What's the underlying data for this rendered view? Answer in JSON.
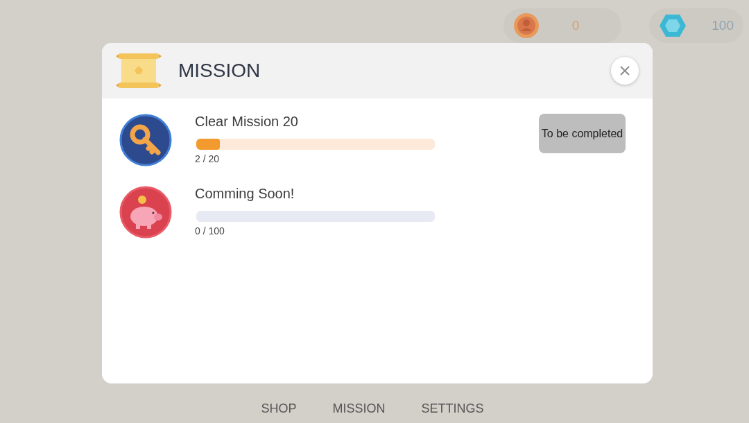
{
  "currencies": [
    {
      "kind": "coin",
      "amount": "0"
    },
    {
      "kind": "gem",
      "amount": "100"
    }
  ],
  "dialog": {
    "title": "MISSION",
    "missions": [
      {
        "kind": "key",
        "title": "Clear Mission 20",
        "level": 0.1,
        "color": "#fde9d9",
        "progress": "2 / 20",
        "action": "To be completed"
      },
      {
        "kind": "piggy",
        "title": "Comming Soon!",
        "color": "#e8eaf3",
        "progress": "0 / 100"
      }
    ]
  },
  "nav": [
    "SHOP",
    "MISSION",
    "SETTINGS"
  ]
}
